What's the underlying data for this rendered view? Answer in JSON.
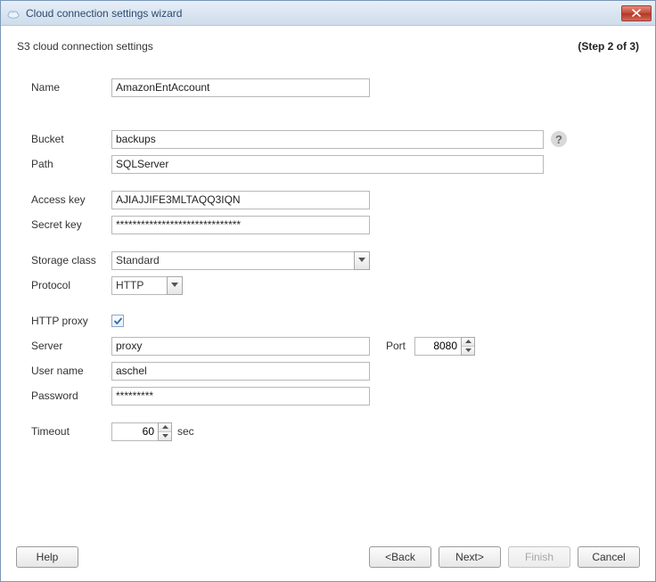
{
  "window": {
    "title": "Cloud connection settings wizard"
  },
  "header": {
    "subtitle": "S3 cloud connection settings",
    "step": "(Step 2 of 3)"
  },
  "fields": {
    "name_label": "Name",
    "name_value": "AmazonEntAccount",
    "bucket_label": "Bucket",
    "bucket_value": "backups",
    "path_label": "Path",
    "path_value": "SQLServer",
    "access_key_label": "Access key",
    "access_key_value": "AJIAJJIFE3MLTAQQ3IQN",
    "secret_key_label": "Secret key",
    "secret_key_value": "******************************",
    "storage_class_label": "Storage class",
    "storage_class_value": "Standard",
    "protocol_label": "Protocol",
    "protocol_value": "HTTP",
    "http_proxy_label": "HTTP proxy",
    "http_proxy_checked": true,
    "server_label": "Server",
    "server_value": "proxy",
    "port_label": "Port",
    "port_value": "8080",
    "user_name_label": "User name",
    "user_name_value": "aschel",
    "password_label": "Password",
    "password_value": "*********",
    "timeout_label": "Timeout",
    "timeout_value": "60",
    "timeout_unit": "sec"
  },
  "icons": {
    "help_bubble": "?"
  },
  "buttons": {
    "help": "Help",
    "back": "<Back",
    "next": "Next>",
    "finish": "Finish",
    "cancel": "Cancel"
  }
}
